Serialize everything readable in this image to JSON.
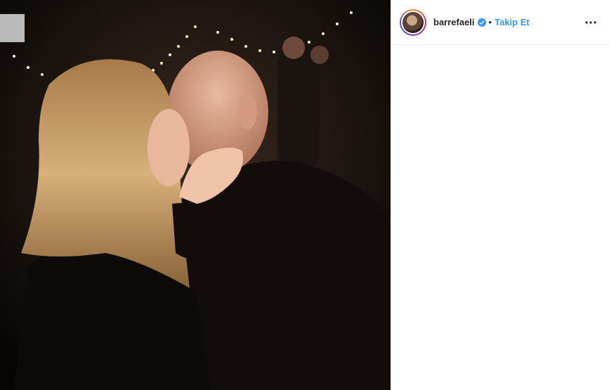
{
  "post": {
    "username": "barrefaeli",
    "separator": "•",
    "follow_label": "Takip Et",
    "verified": true,
    "photo_description": "couple kissing at a party with string lights"
  },
  "icons": {
    "verified": "verified-badge-icon",
    "more": "more-options-icon",
    "avatar": "profile-avatar"
  },
  "colors": {
    "accent": "#3897f0",
    "text": "#262626",
    "border": "#efefef",
    "story_ring": [
      "#f58529",
      "#dd2a7b",
      "#8134af",
      "#515bd4"
    ]
  }
}
